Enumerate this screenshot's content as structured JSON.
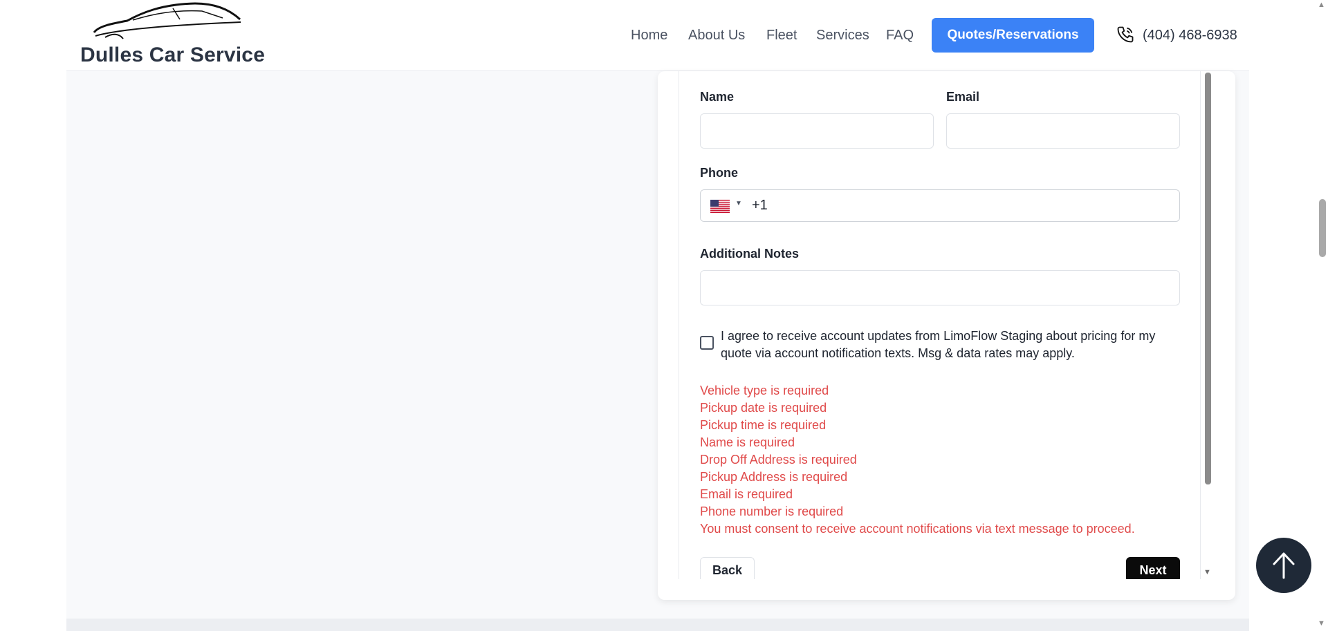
{
  "brand": {
    "name": "Dulles Car Service"
  },
  "nav": {
    "home": "Home",
    "about": "About Us",
    "fleet": "Fleet",
    "services": "Services",
    "faq": "FAQ",
    "quotes": "Quotes/Reservations",
    "phone": "(404) 468-6938"
  },
  "form": {
    "name_label": "Name",
    "name_value": "",
    "email_label": "Email",
    "email_value": "",
    "phone_label": "Phone",
    "phone_country": "US",
    "phone_code": "+1",
    "notes_label": "Additional Notes",
    "notes_value": "",
    "consent_checked": false,
    "consent_text": "I agree to receive account updates from LimoFlow Staging about pricing for my quote via account notification texts. Msg & data rates may apply.",
    "errors": [
      "Vehicle type is required",
      "Pickup date is required",
      "Pickup time is required",
      "Name is required",
      "Drop Off Address is required",
      "Pickup Address is required",
      "Email is required",
      "Phone number is required",
      "You must consent to receive account notifications via text message to proceed."
    ],
    "back_label": "Back",
    "next_label": "Next"
  },
  "colors": {
    "accent": "#3b82f6",
    "error": "#e04a4a",
    "dark": "#1f2937"
  },
  "icons": {
    "phone": "phone-icon",
    "flag": "us-flag-icon",
    "to_top": "arrow-up-icon"
  }
}
